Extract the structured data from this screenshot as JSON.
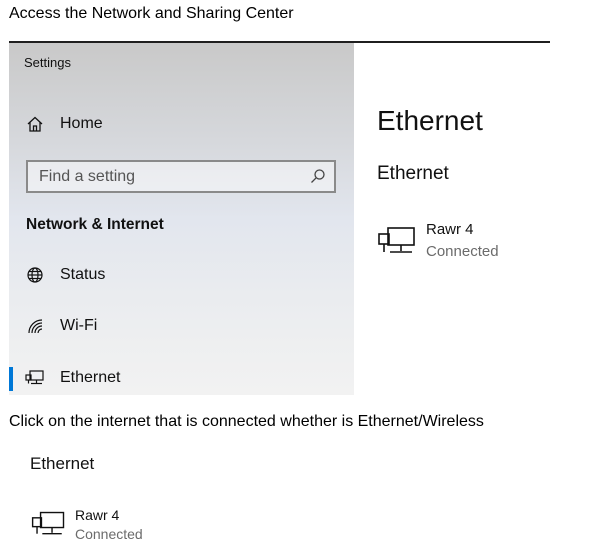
{
  "captions": {
    "step1": "Access the Network and Sharing Center",
    "step2": "Click on the internet that is connected whether is Ethernet/Wireless"
  },
  "settings": {
    "window_title": "Settings",
    "home_label": "Home",
    "search": {
      "placeholder": "Find a setting",
      "value": ""
    },
    "section_title": "Network & Internet",
    "nav_items": [
      {
        "icon": "globe-icon",
        "label": "Status"
      },
      {
        "icon": "wifi-icon",
        "label": "Wi-Fi"
      },
      {
        "icon": "ethernet-icon",
        "label": "Ethernet",
        "active": true
      }
    ],
    "accent_color": "#0078d7"
  },
  "content": {
    "page_title": "Ethernet",
    "section_heading": "Ethernet",
    "network": {
      "icon": "ethernet-icon",
      "name": "Rawr 4",
      "status": "Connected"
    }
  },
  "zoom": {
    "section_heading": "Ethernet",
    "network": {
      "icon": "ethernet-icon",
      "name": "Rawr 4",
      "status": "Connected"
    }
  }
}
